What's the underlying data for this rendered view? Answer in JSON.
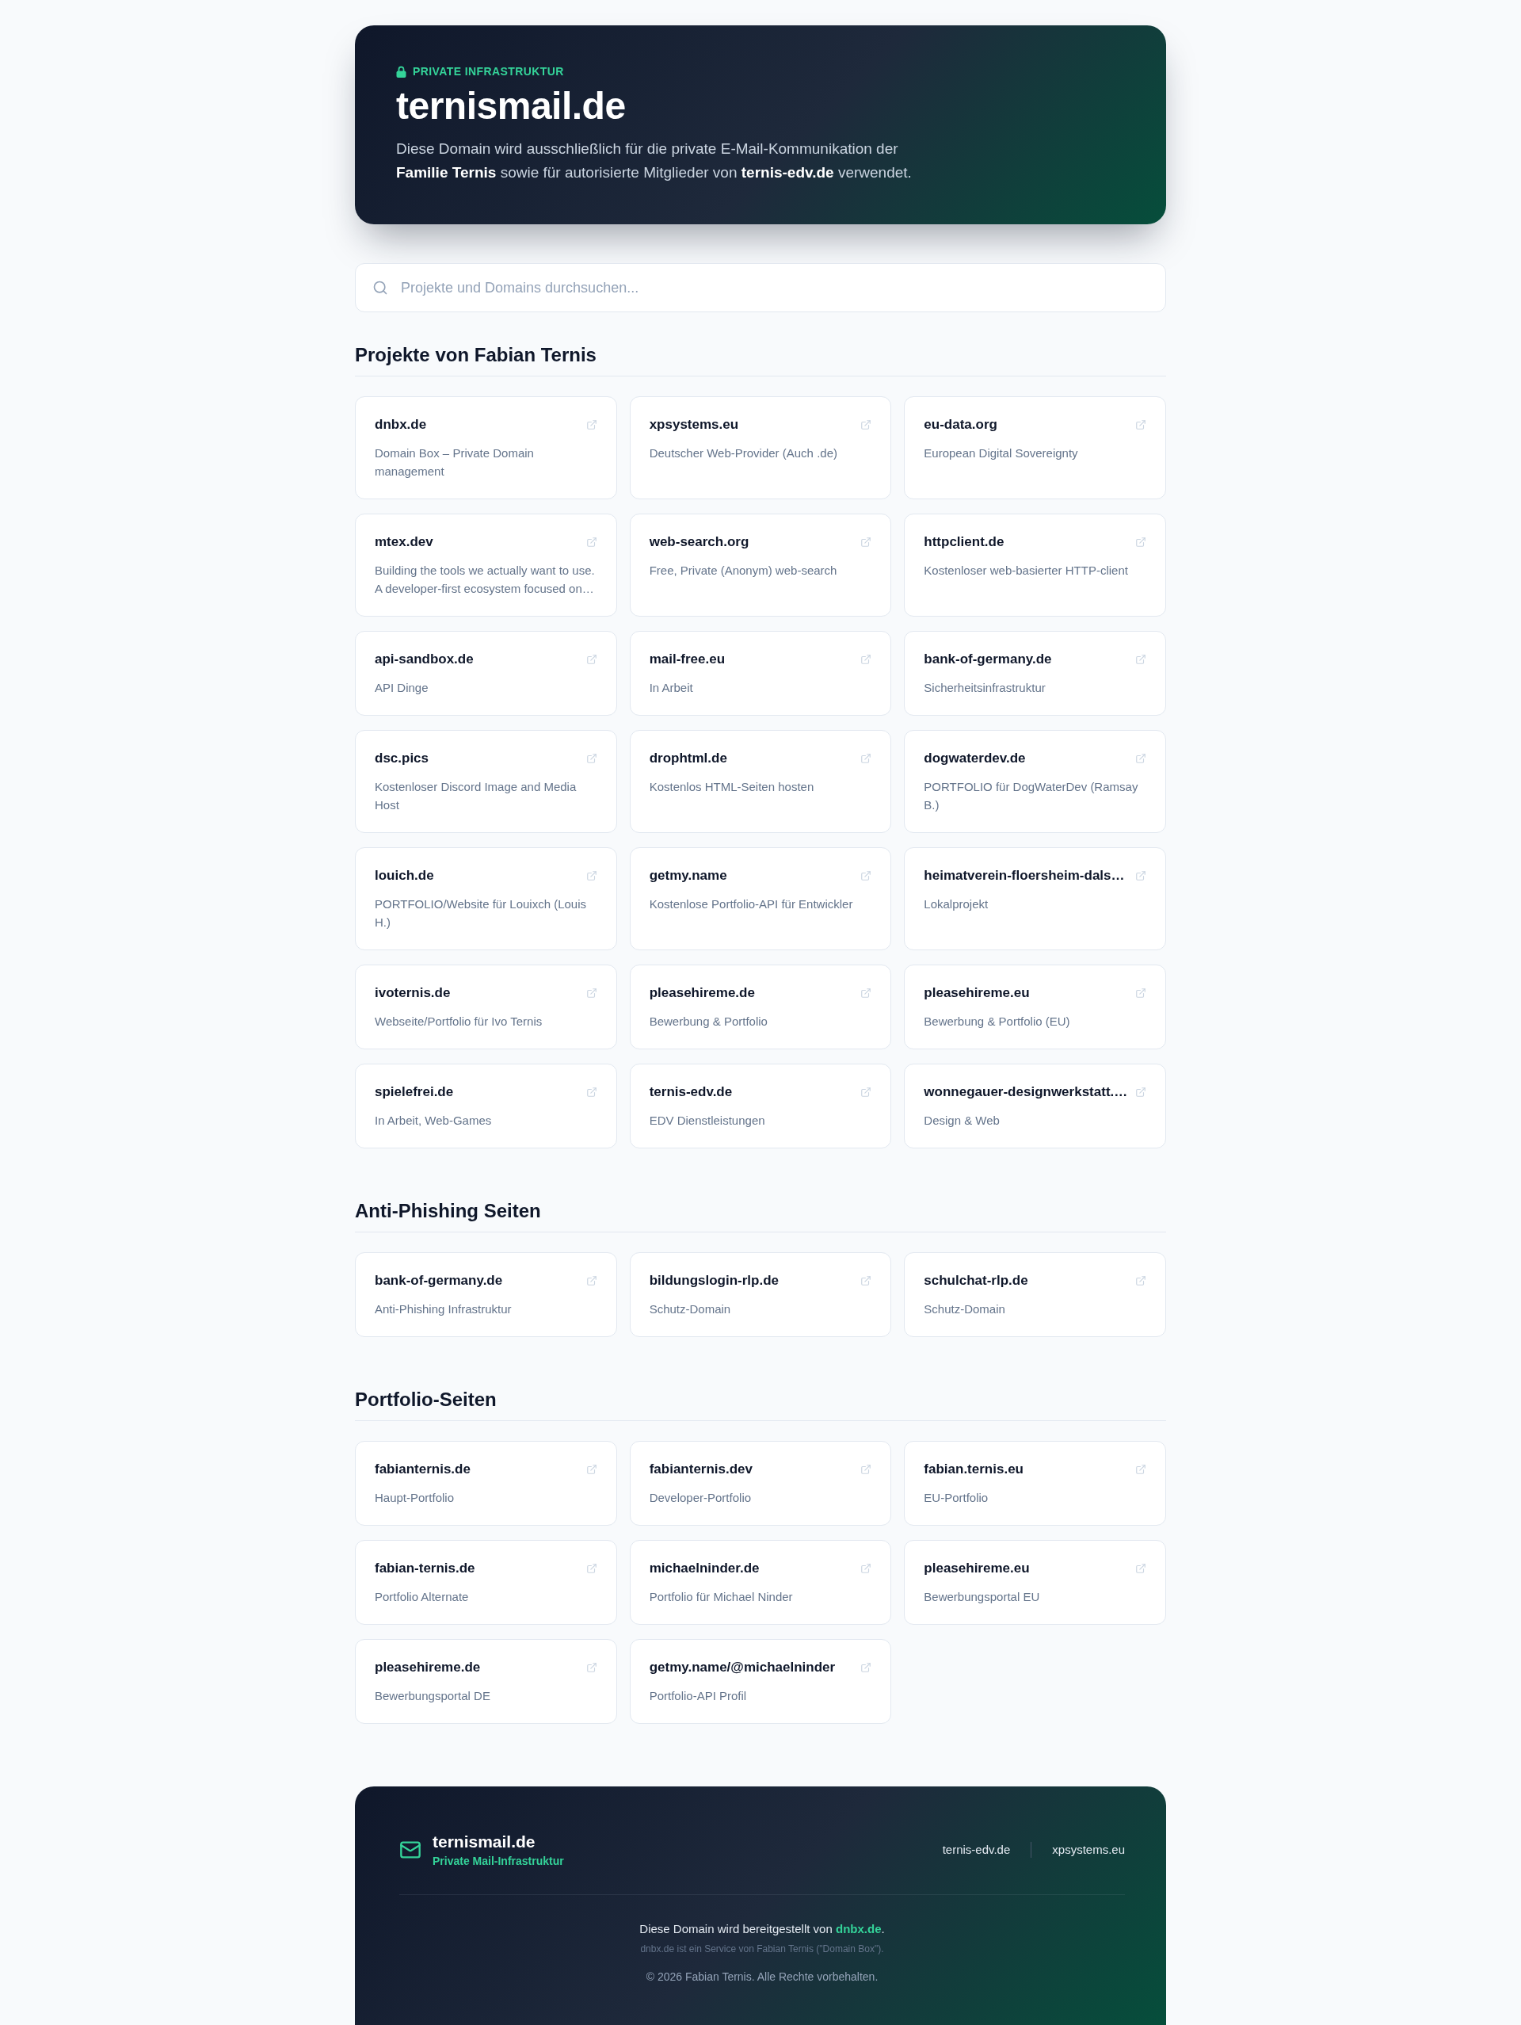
{
  "header": {
    "badge": "PRIVATE INFRASTRUKTUR",
    "title": "ternismail.de",
    "description": "Diese Domain wird ausschließlich für die private E-Mail-Kommunikation der **Familie Ternis** sowie für autorisierte Mitglieder von **ternis-edv.de** verwendet."
  },
  "search": {
    "placeholder": "Projekte und Domains durchsuchen..."
  },
  "sections": [
    {
      "title": "Projekte von Fabian Ternis",
      "cards": [
        {
          "domain": "dnbx.de",
          "description": "Domain Box – Private Domain management"
        },
        {
          "domain": "xpsystems.eu",
          "description": "Deutscher Web-Provider (Auch .de)"
        },
        {
          "domain": "eu-data.org",
          "description": "European Digital Sovereignty"
        },
        {
          "domain": "mtex.dev",
          "description": "Building the tools we actually want to use. A developer-first ecosystem focused on…"
        },
        {
          "domain": "web-search.org",
          "description": "Free, Private (Anonym) web-search"
        },
        {
          "domain": "httpclient.de",
          "description": "Kostenloser web-basierter HTTP-client"
        },
        {
          "domain": "api-sandbox.de",
          "description": "API Dinge"
        },
        {
          "domain": "mail-free.eu",
          "description": "In Arbeit"
        },
        {
          "domain": "bank-of-germany.de",
          "description": "Sicherheitsinfrastruktur"
        },
        {
          "domain": "dsc.pics",
          "description": "Kostenloser Discord Image and Media Host"
        },
        {
          "domain": "drophtml.de",
          "description": "Kostenlos HTML-Seiten hosten"
        },
        {
          "domain": "dogwaterdev.de",
          "description": "PORTFOLIO für DogWaterDev (Ramsay B.)"
        },
        {
          "domain": "louich.de",
          "description": "PORTFOLIO/Website für Louixch (Louis H.)"
        },
        {
          "domain": "getmy.name",
          "description": "Kostenlose Portfolio-API für Entwickler"
        },
        {
          "domain": "heimatverein-floersheim-dals…",
          "description": "Lokalprojekt"
        },
        {
          "domain": "ivoternis.de",
          "description": "Webseite/Portfolio für Ivo Ternis"
        },
        {
          "domain": "pleasehireme.de",
          "description": "Bewerbung & Portfolio"
        },
        {
          "domain": "pleasehireme.eu",
          "description": "Bewerbung & Portfolio (EU)"
        },
        {
          "domain": "spielefrei.de",
          "description": "In Arbeit, Web-Games"
        },
        {
          "domain": "ternis-edv.de",
          "description": "EDV Dienstleistungen"
        },
        {
          "domain": "wonnegauer-designwerkstatt.…",
          "description": "Design & Web"
        }
      ]
    },
    {
      "title": "Anti-Phishing Seiten",
      "cards": [
        {
          "domain": "bank-of-germany.de",
          "description": "Anti-Phishing Infrastruktur"
        },
        {
          "domain": "bildungslogin-rlp.de",
          "description": "Schutz-Domain"
        },
        {
          "domain": "schulchat-rlp.de",
          "description": "Schutz-Domain"
        }
      ]
    },
    {
      "title": "Portfolio-Seiten",
      "cards": [
        {
          "domain": "fabianternis.de",
          "description": "Haupt-Portfolio"
        },
        {
          "domain": "fabianternis.dev",
          "description": "Developer-Portfolio"
        },
        {
          "domain": "fabian.ternis.eu",
          "description": "EU-Portfolio"
        },
        {
          "domain": "fabian-ternis.de",
          "description": "Portfolio Alternate"
        },
        {
          "domain": "michaelninder.de",
          "description": "Portfolio für Michael Ninder"
        },
        {
          "domain": "pleasehireme.eu",
          "description": "Bewerbungsportal EU"
        },
        {
          "domain": "pleasehireme.de",
          "description": "Bewerbungsportal DE"
        },
        {
          "domain": "getmy.name/@michaelninder",
          "description": "Portfolio-API Profil"
        }
      ]
    }
  ],
  "footer": {
    "brand": "ternismail.de",
    "tagline": "Private Mail-Infrastruktur",
    "links": [
      "ternis-edv.de",
      "xpsystems.eu"
    ],
    "provider_note": {
      "text": "Diese Domain wird bereitgestellt von",
      "link": "dnbx.de",
      "end": "."
    },
    "service_note": "dnbx.de ist ein Service von Fabian Ternis (\"Domain Box\").",
    "copyright": "© 2026 Fabian Ternis. Alle Rechte vorbehalten."
  }
}
